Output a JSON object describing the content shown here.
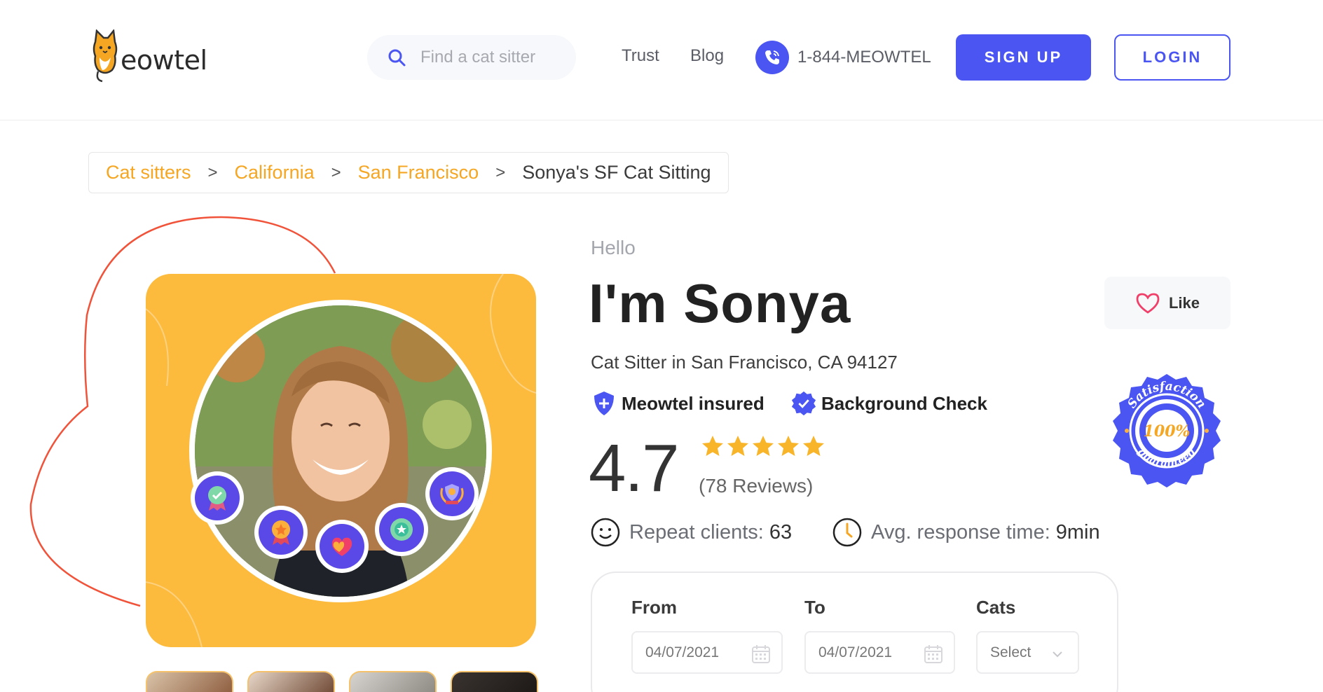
{
  "header": {
    "logo_text": "eowtel",
    "search_placeholder": "Find a cat sitter",
    "nav": {
      "trust": "Trust",
      "blog": "Blog"
    },
    "phone": "1-844-MEOWTEL",
    "signup_label": "SIGN UP",
    "login_label": "LOGIN"
  },
  "breadcrumb": {
    "items": [
      "Cat sitters",
      "California",
      "San Francisco"
    ],
    "current": "Sonya's SF Cat Sitting",
    "separator": ">"
  },
  "profile": {
    "greeting": "Hello",
    "name": "I'm Sonya",
    "subtitle": "Cat Sitter in San Francisco, CA 94127",
    "insured_label": "Meowtel insured",
    "background_label": "Background Check",
    "rating": "4.7",
    "stars": 5,
    "reviews": "(78 Reviews)",
    "repeat_label": "Repeat clients:",
    "repeat_value": "63",
    "response_label": "Avg. response time:",
    "response_value": "9min",
    "like_label": "Like"
  },
  "seal": {
    "top": "Satisfaction",
    "center": "100%",
    "bottom": "guaranteed"
  },
  "booking": {
    "from_label": "From",
    "from_value": "04/07/2021",
    "to_label": "To",
    "to_value": "04/07/2021",
    "cats_label": "Cats",
    "cats_value": "Select"
  },
  "colors": {
    "brand_blue": "#4a55f2",
    "accent_orange": "#f5a623",
    "card_yellow": "#fcbb3d",
    "heart_red": "#f0533a",
    "star_gold": "#f8b52a"
  },
  "icons": [
    "cat-logo-icon",
    "search-icon",
    "phone-icon",
    "shield-plus-icon",
    "verified-check-icon",
    "star-icon",
    "smile-icon",
    "clock-icon",
    "heart-icon",
    "calendar-icon",
    "chevron-down-icon"
  ]
}
